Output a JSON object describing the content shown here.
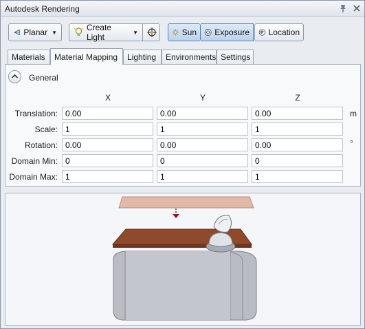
{
  "window": {
    "title": "Autodesk Rendering"
  },
  "toolbar": {
    "mapping_type": "Planar",
    "create_light": "Create Light",
    "sun": "Sun",
    "exposure": "Exposure",
    "location": "Location"
  },
  "tabs": [
    {
      "label": "Materials"
    },
    {
      "label": "Material Mapping"
    },
    {
      "label": "Lighting"
    },
    {
      "label": "Environments"
    },
    {
      "label": "Settings"
    }
  ],
  "selected_tab": "Material Mapping",
  "general": {
    "title": "General",
    "columns": [
      "X",
      "Y",
      "Z"
    ],
    "rows": [
      {
        "label": "Translation:",
        "x": "0.00",
        "y": "0.00",
        "z": "0.00",
        "unit": "m"
      },
      {
        "label": "Scale:",
        "x": "1",
        "y": "1",
        "z": "1",
        "unit": ""
      },
      {
        "label": "Rotation:",
        "x": "0.00",
        "y": "0.00",
        "z": "0.00",
        "unit": "°"
      },
      {
        "label": "Domain Min:",
        "x": "0",
        "y": "0",
        "z": "0",
        "unit": ""
      },
      {
        "label": "Domain Max:",
        "x": "1",
        "y": "1",
        "z": "1",
        "unit": ""
      }
    ]
  },
  "colors": {
    "active_button": "#bcd3ee",
    "plane": "#e2b8a6",
    "wood": "#8f4a2c",
    "gray_body": "#b9bcc2"
  },
  "icons": [
    "pin-icon",
    "close-icon",
    "planar-icon",
    "light-bulb-icon",
    "target-icon",
    "sun-icon",
    "exposure-icon",
    "location-icon",
    "collapse-icon"
  ]
}
